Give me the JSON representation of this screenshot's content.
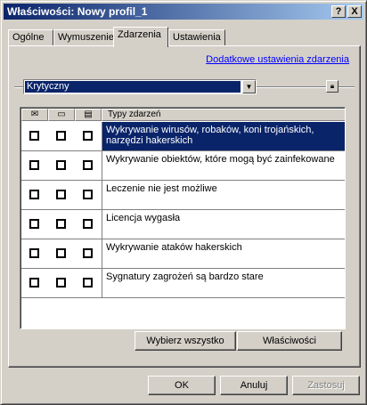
{
  "window": {
    "title": "Właściwości: Nowy profil_1",
    "help_label": "?",
    "close_label": "X"
  },
  "tabs": [
    {
      "label": "Ogólne"
    },
    {
      "label": "Wymuszenie"
    },
    {
      "label": "Zdarzenia",
      "active": true
    },
    {
      "label": "Ustawienia"
    }
  ],
  "panel": {
    "link": "Dodatkowe ustawienia zdarzenia",
    "severity": {
      "selected": "Krytyczny"
    },
    "list": {
      "column_header": "Typy zdarzeń",
      "column_icons": [
        "mail-icon",
        "computer-icon",
        "log-icon"
      ],
      "rows": [
        {
          "text": "Wykrywanie wirusów, robaków, koni trojańskich, narzędzi hakerskich",
          "selected": true
        },
        {
          "text": "Wykrywanie obiektów, które mogą być zainfekowane"
        },
        {
          "text": "Leczenie nie jest możliwe"
        },
        {
          "text": "Licencja wygasła"
        },
        {
          "text": "Wykrywanie ataków hakerskich"
        },
        {
          "text": "Sygnatury zagrożeń są bardzo stare"
        }
      ]
    },
    "buttons": {
      "select_all": "Wybierz wszystko",
      "properties": "Właściwości"
    }
  },
  "footer": {
    "ok": "OK",
    "cancel": "Anuluj",
    "apply": "Zastosuj"
  },
  "colors": {
    "selection": "#0a246a",
    "face": "#d4d0c8",
    "link": "#0000ff"
  }
}
